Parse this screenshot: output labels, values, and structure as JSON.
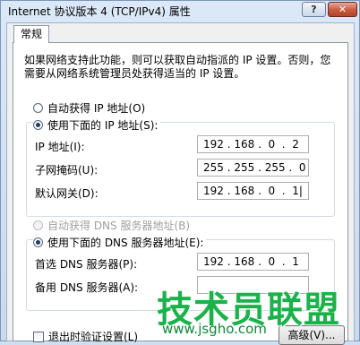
{
  "window": {
    "title": "Internet 协议版本 4 (TCP/IPv4) 属性",
    "help_label": "?",
    "close_label": "✕"
  },
  "tabs": [
    {
      "label": "常规"
    }
  ],
  "description": "如果网络支持此功能，则可以获取自动指派的 IP 设置。否则，您需要从网络系统管理员处获得适当的 IP 设置。",
  "ip_section": {
    "auto_option": "自动获得 IP 地址(O)",
    "manual_option": "使用下面的 IP 地址(S):",
    "selected": "manual",
    "fields": [
      {
        "label": "IP 地址(I):",
        "value": "192 . 168 .  0  .  2"
      },
      {
        "label": "子网掩码(U):",
        "value": "255 . 255 . 255 .  0"
      },
      {
        "label": "默认网关(D):",
        "value": "192 . 168 .  0  .  1|"
      }
    ]
  },
  "dns_section": {
    "auto_option": "自动获得 DNS 服务器地址(B)",
    "manual_option": "使用下面的 DNS 服务器地址(E):",
    "selected": "manual",
    "fields": [
      {
        "label": "首选 DNS 服务器(P):",
        "value": "192 . 168 .  0  .  1"
      },
      {
        "label": "备用 DNS 服务器(A):",
        "value": ""
      }
    ]
  },
  "validate_checkbox": {
    "label": "退出时验证设置(L)",
    "checked": false
  },
  "advanced_button": "高级(V)...",
  "watermark": {
    "main": "技术员联盟",
    "sub": "www.jsgho.com"
  }
}
